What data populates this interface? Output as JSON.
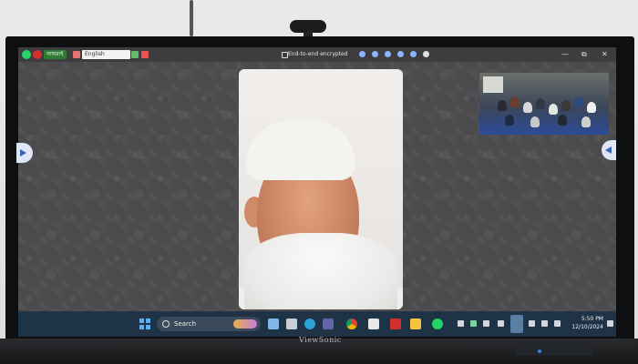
{
  "window": {
    "app_label": "আমরাই",
    "language_select": "English",
    "encryption_status": "End-to-end encrypted",
    "controls": [
      "—",
      "⧉",
      "✕"
    ]
  },
  "taskbar": {
    "search_label": "Search",
    "time": "5:50 PM",
    "date": "12/10/2024"
  },
  "monitor": {
    "brand": "ViewSonic"
  },
  "colors": {
    "whatsapp_green": "#25d366",
    "taskbar_bg": "#1f3346",
    "chat_wallpaper": "#4b4b4e"
  }
}
